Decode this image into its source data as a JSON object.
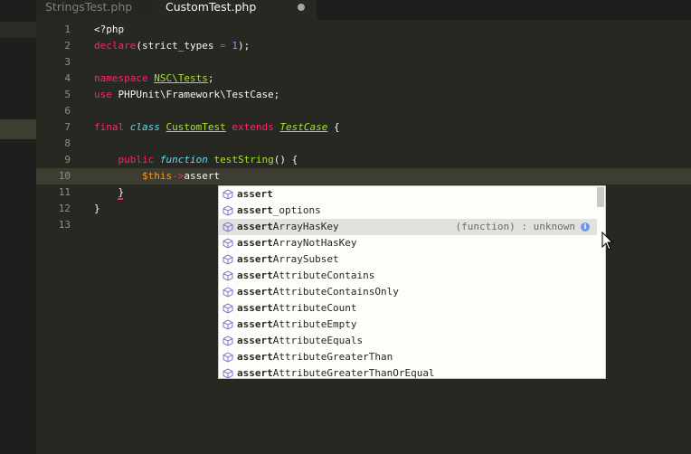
{
  "tabs": [
    {
      "label": "StringsTest.php",
      "active": false
    },
    {
      "label": "CustomTest.php",
      "active": true,
      "modified": true
    }
  ],
  "editor": {
    "lines": [
      {
        "n": "1",
        "tokens": [
          {
            "t": "<?php",
            "c": ""
          }
        ]
      },
      {
        "n": "2",
        "tokens": [
          {
            "t": "declare",
            "c": "kw"
          },
          {
            "t": "(",
            "c": ""
          },
          {
            "t": "strict_types",
            "c": ""
          },
          {
            "t": " = ",
            "c": "kw"
          },
          {
            "t": "1",
            "c": "num"
          },
          {
            "t": ");",
            "c": ""
          }
        ]
      },
      {
        "n": "3",
        "tokens": []
      },
      {
        "n": "4",
        "tokens": [
          {
            "t": "namespace",
            "c": "kw"
          },
          {
            "t": " ",
            "c": ""
          },
          {
            "t": "NSC\\Tests",
            "c": "fn und"
          },
          {
            "t": ";",
            "c": ""
          }
        ]
      },
      {
        "n": "5",
        "tokens": [
          {
            "t": "use",
            "c": "kw"
          },
          {
            "t": " PHPUnit\\Framework\\TestCase;",
            "c": ""
          }
        ]
      },
      {
        "n": "6",
        "tokens": []
      },
      {
        "n": "7",
        "tokens": [
          {
            "t": "final",
            "c": "kw"
          },
          {
            "t": " ",
            "c": ""
          },
          {
            "t": "class",
            "c": "blue ital"
          },
          {
            "t": " ",
            "c": ""
          },
          {
            "t": "CustomTest",
            "c": "fn und"
          },
          {
            "t": " ",
            "c": ""
          },
          {
            "t": "extends",
            "c": "kw"
          },
          {
            "t": " ",
            "c": ""
          },
          {
            "t": "TestCase",
            "c": "fn ital und"
          },
          {
            "t": " {",
            "c": ""
          }
        ]
      },
      {
        "n": "8",
        "tokens": []
      },
      {
        "n": "9",
        "tokens": [
          {
            "t": "    ",
            "c": ""
          },
          {
            "t": "public",
            "c": "kw"
          },
          {
            "t": " ",
            "c": ""
          },
          {
            "t": "function",
            "c": "blue ital"
          },
          {
            "t": " ",
            "c": ""
          },
          {
            "t": "testString",
            "c": "fn"
          },
          {
            "t": "() {",
            "c": ""
          }
        ]
      },
      {
        "n": "10",
        "tokens": [
          {
            "t": "        ",
            "c": ""
          },
          {
            "t": "$this",
            "c": "var"
          },
          {
            "t": "->",
            "c": "kw"
          },
          {
            "t": "assert",
            "c": ""
          }
        ],
        "current": true
      },
      {
        "n": "11",
        "tokens": [
          {
            "t": "    }",
            "c": ""
          }
        ]
      },
      {
        "n": "12",
        "tokens": [
          {
            "t": "}",
            "c": ""
          }
        ]
      },
      {
        "n": "13",
        "tokens": []
      }
    ]
  },
  "autocomplete": {
    "typed": "assert",
    "selected_index": 2,
    "items": [
      {
        "match": "assert",
        "rest": "",
        "detail": ""
      },
      {
        "match": "assert",
        "rest": "_options",
        "detail": ""
      },
      {
        "match": "assert",
        "rest": "ArrayHasKey",
        "detail": "(function) : unknown"
      },
      {
        "match": "assert",
        "rest": "ArrayNotHasKey",
        "detail": ""
      },
      {
        "match": "assert",
        "rest": "ArraySubset",
        "detail": ""
      },
      {
        "match": "assert",
        "rest": "AttributeContains",
        "detail": ""
      },
      {
        "match": "assert",
        "rest": "AttributeContainsOnly",
        "detail": ""
      },
      {
        "match": "assert",
        "rest": "AttributeCount",
        "detail": ""
      },
      {
        "match": "assert",
        "rest": "AttributeEmpty",
        "detail": ""
      },
      {
        "match": "assert",
        "rest": "AttributeEquals",
        "detail": ""
      },
      {
        "match": "assert",
        "rest": "AttributeGreaterThan",
        "detail": ""
      },
      {
        "match": "assert",
        "rest": "AttributeGreaterThanOrEqual",
        "detail": ""
      }
    ],
    "info_icon": "info-icon",
    "item_icon": "cube-icon"
  },
  "colors": {
    "background": "#272822",
    "keyword": "#f92672",
    "function": "#a6e22e",
    "number": "#ae81ff",
    "variable": "#fd971f"
  }
}
